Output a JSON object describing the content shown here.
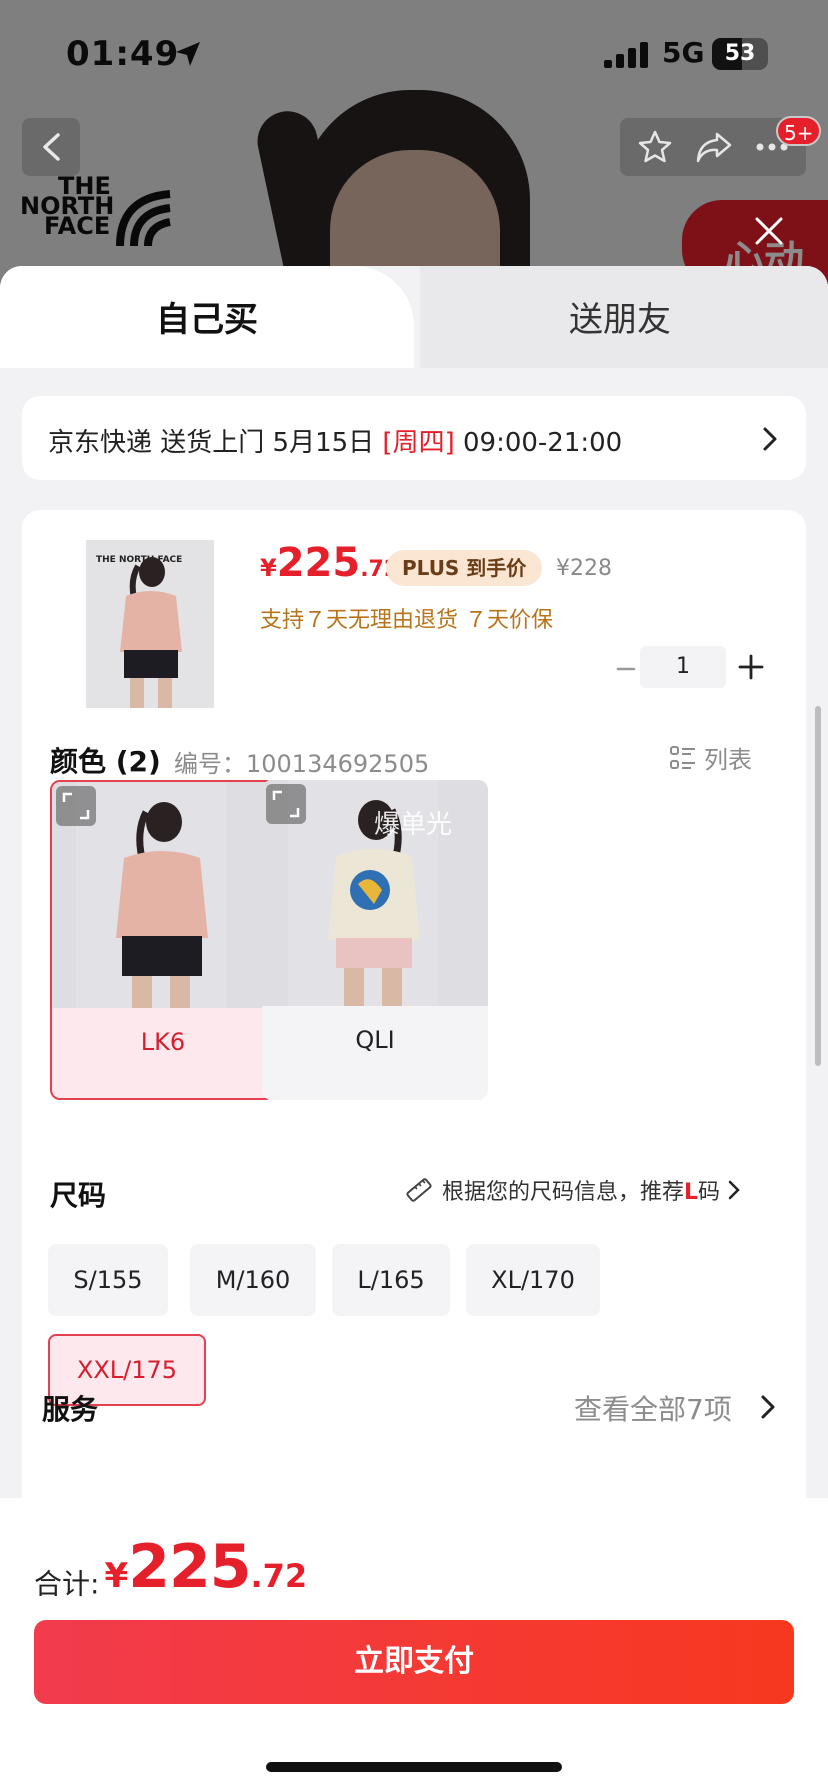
{
  "status_bar": {
    "time": "01:49",
    "network": "5G",
    "battery": "53"
  },
  "background": {
    "brand_logo": [
      "THE",
      "NORTH",
      "FACE"
    ],
    "cart_badge": "5+",
    "promo_tag": "心动"
  },
  "tabs": [
    {
      "label": "自己买",
      "active": true
    },
    {
      "label": "送朋友",
      "active": false
    }
  ],
  "delivery": {
    "text": "京东快递 送货上门 5月15日 ",
    "weekday": "[周四]",
    "time_window": " 09:00-21:00"
  },
  "product": {
    "price_symbol": "¥",
    "price_int": "225",
    "price_dec": ".72",
    "plus_label": "PLUS 到手价",
    "original_price": "¥228",
    "guarantees": "支持７天无理由退货   ７天价保",
    "quantity": "1"
  },
  "color": {
    "title": "颜色 (2)",
    "sku_label": "编号：100134692505",
    "list_label": "列表",
    "options": [
      {
        "label": "LK6",
        "selected": true,
        "swatch": "#e4b3a6"
      },
      {
        "label": "QLI",
        "selected": false,
        "swatch": "#ece6d6"
      }
    ],
    "watermark": "爆单光"
  },
  "size": {
    "title": "尺码",
    "hint_prefix": "根据您的尺码信息，推荐",
    "hint_size": "L",
    "hint_suffix": "码",
    "options": [
      {
        "label": "S/155",
        "selected": false
      },
      {
        "label": "M/160",
        "selected": false
      },
      {
        "label": "L/165",
        "selected": false
      },
      {
        "label": "XL/170",
        "selected": false
      },
      {
        "label": "XXL/175",
        "selected": true
      }
    ]
  },
  "service": {
    "title": "服务",
    "more": "查看全部7项"
  },
  "footer": {
    "total_label": "合计:",
    "total_symbol": "¥",
    "total_int": "225",
    "total_dec": ".72",
    "pay_button": "立即支付"
  },
  "colors": {
    "accent_red": "#e5202b",
    "plus_badge_bg": "#fbe6d4",
    "guarantee_text": "#b8741a"
  }
}
